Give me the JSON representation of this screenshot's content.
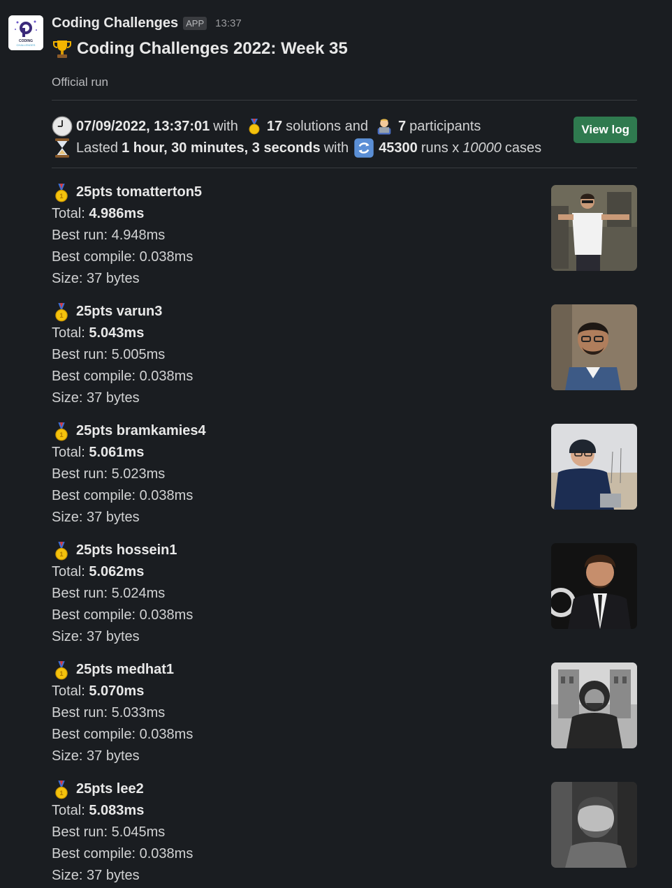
{
  "app": {
    "name": "Coding Challenges",
    "badge": "APP",
    "time": "13:37",
    "logo_text": "CODING CHALLENGES"
  },
  "message": {
    "title": "Coding Challenges 2022: Week 35",
    "subtitle": "Official run",
    "date_time": "07/09/2022, 13:37:01",
    "with_1": "with",
    "solutions_count": "17",
    "solutions_label": "solutions and",
    "participants_count": "7",
    "participants_label": "participants",
    "lasted_label": "Lasted",
    "duration": "1 hour, 30 minutes, 3 seconds",
    "with_2": "with",
    "runs_count": "45300",
    "runs_label": "runs x",
    "cases_count": "10000",
    "cases_label": "cases",
    "view_log_label": "View log"
  },
  "entries": [
    {
      "head": "25pts tomatterton5",
      "total_label": "Total:",
      "total": "4.986ms",
      "best_run": "Best run: 4.948ms",
      "best_compile": "Best compile: 0.038ms",
      "size": "Size: 37 bytes"
    },
    {
      "head": "25pts varun3",
      "total_label": "Total:",
      "total": "5.043ms",
      "best_run": "Best run: 5.005ms",
      "best_compile": "Best compile: 0.038ms",
      "size": "Size: 37 bytes"
    },
    {
      "head": "25pts bramkamies4",
      "total_label": "Total:",
      "total": "5.061ms",
      "best_run": "Best run: 5.023ms",
      "best_compile": "Best compile: 0.038ms",
      "size": "Size: 37 bytes"
    },
    {
      "head": "25pts hossein1",
      "total_label": "Total:",
      "total": "5.062ms",
      "best_run": "Best run: 5.024ms",
      "best_compile": "Best compile: 0.038ms",
      "size": "Size: 37 bytes"
    },
    {
      "head": "25pts medhat1",
      "total_label": "Total:",
      "total": "5.070ms",
      "best_run": "Best run: 5.033ms",
      "best_compile": "Best compile: 0.038ms",
      "size": "Size: 37 bytes"
    },
    {
      "head": "25pts lee2",
      "total_label": "Total:",
      "total": "5.083ms",
      "best_run": "Best run: 5.045ms",
      "best_compile": "Best compile: 0.038ms",
      "size": "Size: 37 bytes"
    }
  ],
  "icons": {
    "title": "trophy-icon",
    "date": "clock-icon",
    "solutions": "medal-icon",
    "participants": "technologist-icon",
    "duration": "hourglass-icon",
    "runs": "repeat-icon",
    "entry": "gold-medal-icon"
  },
  "colors": {
    "background": "#1a1d21",
    "accent_button": "#2f7a4f",
    "divider": "#393b3f",
    "text": "#d1d2d3"
  }
}
